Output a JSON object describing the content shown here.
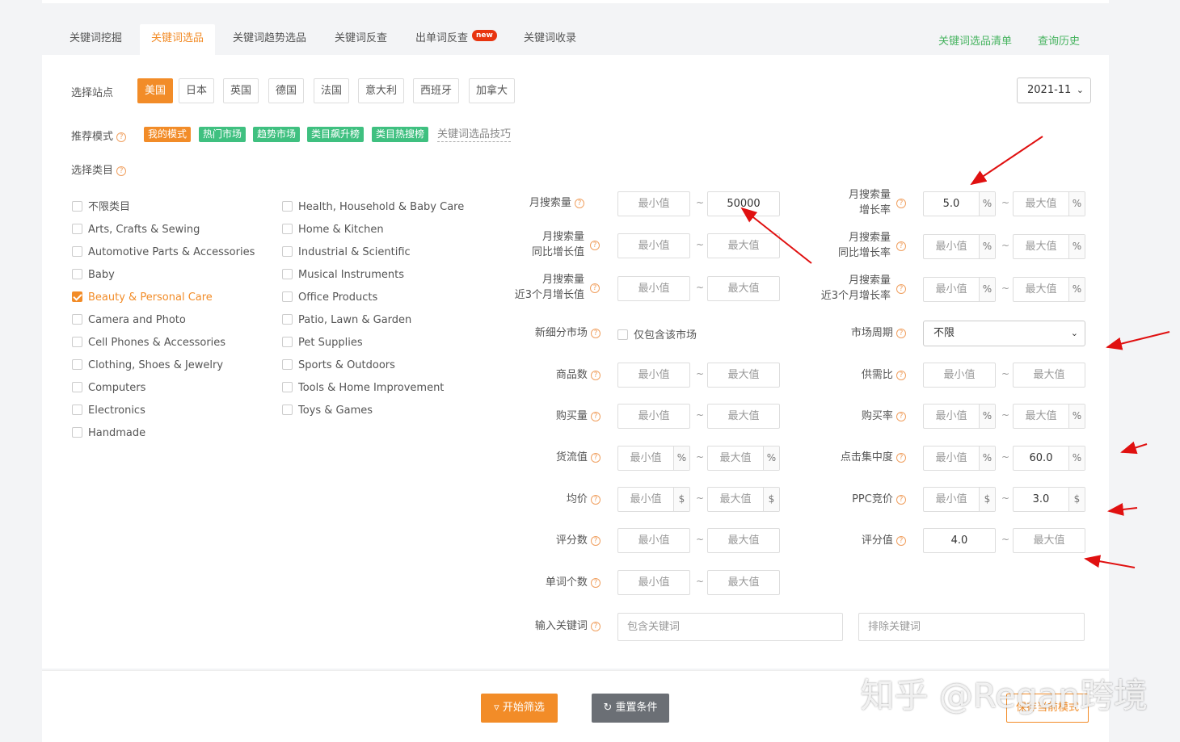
{
  "tabs": [
    {
      "label": "关键词挖掘"
    },
    {
      "label": "关键词选品",
      "active": true
    },
    {
      "label": "关键词趋势选品"
    },
    {
      "label": "关键词反查"
    },
    {
      "label": "出单词反查",
      "badge": "new"
    },
    {
      "label": "关键词收录"
    }
  ],
  "top_links": {
    "list": "关键词选品清单",
    "history": "查询历史"
  },
  "site": {
    "label": "选择站点",
    "options": [
      "美国",
      "日本",
      "英国",
      "德国",
      "法国",
      "意大利",
      "西班牙",
      "加拿大"
    ],
    "selected": "美国",
    "month": "2021-11"
  },
  "mode": {
    "label": "推荐模式",
    "tags": [
      "我的模式",
      "热门市场",
      "趋势市场",
      "类目飙升榜",
      "类目热搜榜"
    ],
    "tip_link": "关键词选品技巧"
  },
  "category": {
    "label": "选择类目",
    "col1": [
      "不限类目",
      "Arts, Crafts & Sewing",
      "Automotive Parts & Accessories",
      "Baby",
      "Beauty & Personal Care",
      "Camera and Photo",
      "Cell Phones & Accessories",
      "Clothing, Shoes & Jewelry",
      "Computers",
      "Electronics",
      "Handmade"
    ],
    "col2": [
      "Health, Household & Baby Care",
      "Home & Kitchen",
      "Industrial & Scientific",
      "Musical Instruments",
      "Office Products",
      "Patio, Lawn & Garden",
      "Pet Supplies",
      "Sports & Outdoors",
      "Tools & Home Improvement",
      "Toys & Games"
    ],
    "checked": "Beauty & Personal Care"
  },
  "placeholders": {
    "min": "最小值",
    "max": "最大值"
  },
  "units": {
    "pct": "%",
    "usd": "$"
  },
  "filters": {
    "monthly_search": {
      "label": "月搜索量",
      "max": "50000"
    },
    "monthly_search_growth": {
      "label1": "月搜索量",
      "label2": "增长率",
      "min": "5.0"
    },
    "yoy_growth": {
      "label1": "月搜索量",
      "label2": "同比增长值"
    },
    "yoy_growth_rate": {
      "label1": "月搜索量",
      "label2": "同比增长率"
    },
    "q3_growth": {
      "label1": "月搜索量",
      "label2": "近3个月增长值"
    },
    "q3_growth_rate": {
      "label1": "月搜索量",
      "label2": "近3个月增长率"
    },
    "new_market": {
      "label": "新细分市场",
      "checkbox": "仅包含该市场"
    },
    "market_cycle": {
      "label": "市场周期",
      "value": "不限"
    },
    "products": {
      "label": "商品数"
    },
    "supply_demand": {
      "label": "供需比"
    },
    "purchases": {
      "label": "购买量"
    },
    "purchase_rate": {
      "label": "购买率"
    },
    "gmv": {
      "label": "货流值"
    },
    "click_concentration": {
      "label": "点击集中度",
      "max": "60.0"
    },
    "avg_price": {
      "label": "均价"
    },
    "ppc_bid": {
      "label": "PPC竞价",
      "max": "3.0"
    },
    "reviews": {
      "label": "评分数"
    },
    "rating": {
      "label": "评分值",
      "min": "4.0"
    },
    "word_count": {
      "label": "单词个数"
    },
    "keywords": {
      "label": "输入关键词",
      "include_placeholder": "包含关键词",
      "exclude_placeholder": "排除关键词"
    }
  },
  "buttons": {
    "start": "开始筛选",
    "reset": "重置条件",
    "save": "保存当前模式"
  },
  "watermark": "知乎 @Regan跨境",
  "colors": {
    "accent": "#f28c28",
    "tag_green": "#3fc080",
    "link_green": "#46b35f",
    "arrow": "#e01010"
  }
}
